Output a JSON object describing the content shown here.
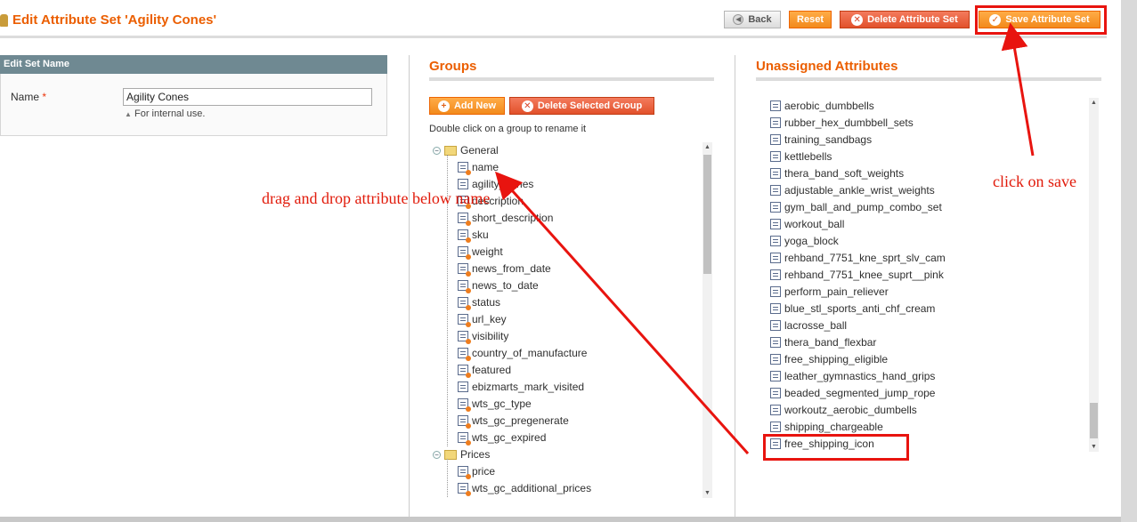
{
  "header": {
    "title": "Edit Attribute Set 'Agility Cones'",
    "back_label": "Back",
    "reset_label": "Reset",
    "delete_label": "Delete Attribute Set",
    "save_label": "Save Attribute Set"
  },
  "set_name": {
    "section_title": "Edit Set Name",
    "field_label": "Name",
    "required_mark": "*",
    "value": "Agility Cones",
    "hint": "For internal use."
  },
  "groups": {
    "title": "Groups",
    "add_label": "Add New",
    "delete_label": "Delete Selected Group",
    "hint": "Double click on a group to rename it",
    "tree": [
      {
        "name": "General",
        "items": [
          {
            "label": "name",
            "sys": true
          },
          {
            "label": "agility_cones",
            "sys": false
          },
          {
            "label": "description",
            "sys": true
          },
          {
            "label": "short_description",
            "sys": true
          },
          {
            "label": "sku",
            "sys": true
          },
          {
            "label": "weight",
            "sys": true
          },
          {
            "label": "news_from_date",
            "sys": true
          },
          {
            "label": "news_to_date",
            "sys": true
          },
          {
            "label": "status",
            "sys": true
          },
          {
            "label": "url_key",
            "sys": true
          },
          {
            "label": "visibility",
            "sys": true
          },
          {
            "label": "country_of_manufacture",
            "sys": true
          },
          {
            "label": "featured",
            "sys": true
          },
          {
            "label": "ebizmarts_mark_visited",
            "sys": false
          },
          {
            "label": "wts_gc_type",
            "sys": true
          },
          {
            "label": "wts_gc_pregenerate",
            "sys": true
          },
          {
            "label": "wts_gc_expired",
            "sys": true
          }
        ]
      },
      {
        "name": "Prices",
        "items": [
          {
            "label": "price",
            "sys": true
          },
          {
            "label": "wts_gc_additional_prices",
            "sys": true
          }
        ]
      }
    ]
  },
  "unassigned": {
    "title": "Unassigned Attributes",
    "items": [
      "aerobic_dumbbells",
      "rubber_hex_dumbbell_sets",
      "training_sandbags",
      "kettlebells",
      "thera_band_soft_weights",
      "adjustable_ankle_wrist_weights",
      "gym_ball_and_pump_combo_set",
      "workout_ball",
      "yoga_block",
      "rehband_7751_kne_sprt_slv_cam",
      "rehband_7751_knee_suprt__pink",
      "perform_pain_reliever",
      "blue_stl_sports_anti_chf_cream",
      "lacrosse_ball",
      "thera_band_flexbar",
      "free_shipping_eligible",
      "leather_gymnastics_hand_grips",
      "beaded_segmented_jump_rope",
      "workoutz_aerobic_dumbells",
      "shipping_chargeable",
      "free_shipping_icon"
    ]
  },
  "annotations": {
    "drag_text": "drag and drop attribute below name",
    "save_text": "click on save"
  },
  "colors": {
    "accent": "#eb5e00",
    "annotation": "#e11a0a"
  }
}
